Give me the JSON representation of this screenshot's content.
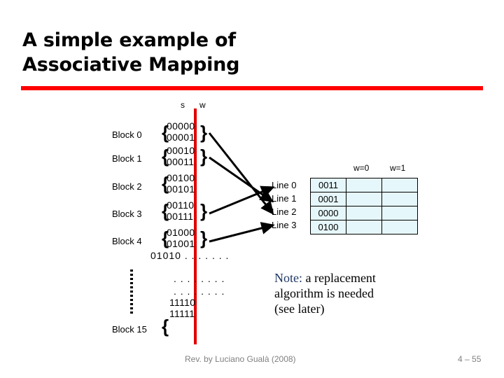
{
  "slide": {
    "title_line1": "A simple example of",
    "title_line2": "Associative Mapping",
    "accent_color": "#ff0000",
    "divider_color": "#e00000"
  },
  "memory": {
    "axis_labels": {
      "s": "s",
      "w": "w"
    },
    "blocks": [
      {
        "label": "Block 0",
        "words": [
          "00000",
          "00001"
        ]
      },
      {
        "label": "Block 1",
        "words": [
          "00010",
          "00011"
        ]
      },
      {
        "label": "Block 2",
        "words": [
          "00100",
          "00101"
        ]
      },
      {
        "label": "Block 3",
        "words": [
          "00110",
          "00111"
        ]
      },
      {
        "label": "Block 4",
        "words": [
          "01000",
          "01001"
        ]
      }
    ],
    "tail_words": [
      "01010 . . . . . . .",
      ". . . . . . . .",
      ". . . . . . . .",
      "11110",
      "11111"
    ],
    "last_block_label": "Block 15"
  },
  "cache": {
    "col_headers": [
      "w=0",
      "w=1"
    ],
    "rows": [
      {
        "line": "Line 0",
        "tag": "0011",
        "w0": "",
        "w1": ""
      },
      {
        "line": "Line 1",
        "tag": "0001",
        "w0": "",
        "w1": ""
      },
      {
        "line": "Line 2",
        "tag": "0000",
        "w0": "",
        "w1": ""
      },
      {
        "line": "Line 3",
        "tag": "0100",
        "w0": "",
        "w1": ""
      }
    ],
    "cell_color": "#e6f7fb"
  },
  "note": {
    "keyword": "Note:",
    "text_rest": " a replacement",
    "line2": "algorithm is needed",
    "line3": "(see later)"
  },
  "footer": {
    "credit": "Rev. by Luciano Gualà (2008)",
    "page": "4 –  55"
  }
}
